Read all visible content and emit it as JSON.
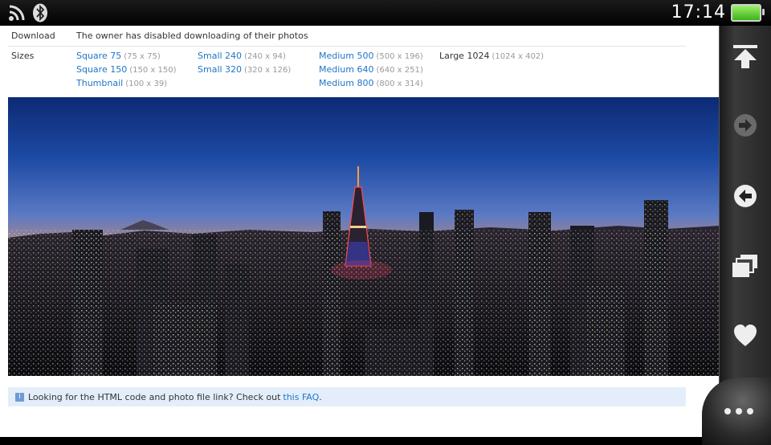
{
  "status": {
    "time": "17:14",
    "icons": [
      "wifi-icon",
      "bluetooth-icon",
      "battery-icon"
    ]
  },
  "page": {
    "download_label": "Download",
    "download_text": "The owner has disabled downloading of their photos",
    "sizes_label": "Sizes",
    "sizes": [
      [
        {
          "name": "Square 75",
          "dim": "(75 x 75)"
        },
        {
          "name": "Square 150",
          "dim": "(150 x 150)"
        },
        {
          "name": "Thumbnail",
          "dim": "(100 x 39)"
        }
      ],
      [
        {
          "name": "Small 240",
          "dim": "(240 x 94)"
        },
        {
          "name": "Small 320",
          "dim": "(320 x 126)"
        }
      ],
      [
        {
          "name": "Medium 500",
          "dim": "(500 x 196)"
        },
        {
          "name": "Medium 640",
          "dim": "(640 x 251)"
        },
        {
          "name": "Medium 800",
          "dim": "(800 x 314)"
        }
      ],
      [
        {
          "name": "Large 1024",
          "dim": "(1024 x 402)",
          "current": true
        }
      ]
    ],
    "faq_text": "Looking for the HTML code and photo file link? Check out ",
    "faq_link": "this FAQ",
    "faq_end": "."
  },
  "colors": {
    "link": "#1f75c8",
    "dim": "#9a9a9a",
    "faq_bg": "#e4eefb"
  },
  "sidebar": {
    "buttons": [
      "scroll-top-icon",
      "forward-icon",
      "back-icon",
      "windows-icon",
      "bookmark-heart-icon"
    ],
    "more": "more-options-icon"
  }
}
